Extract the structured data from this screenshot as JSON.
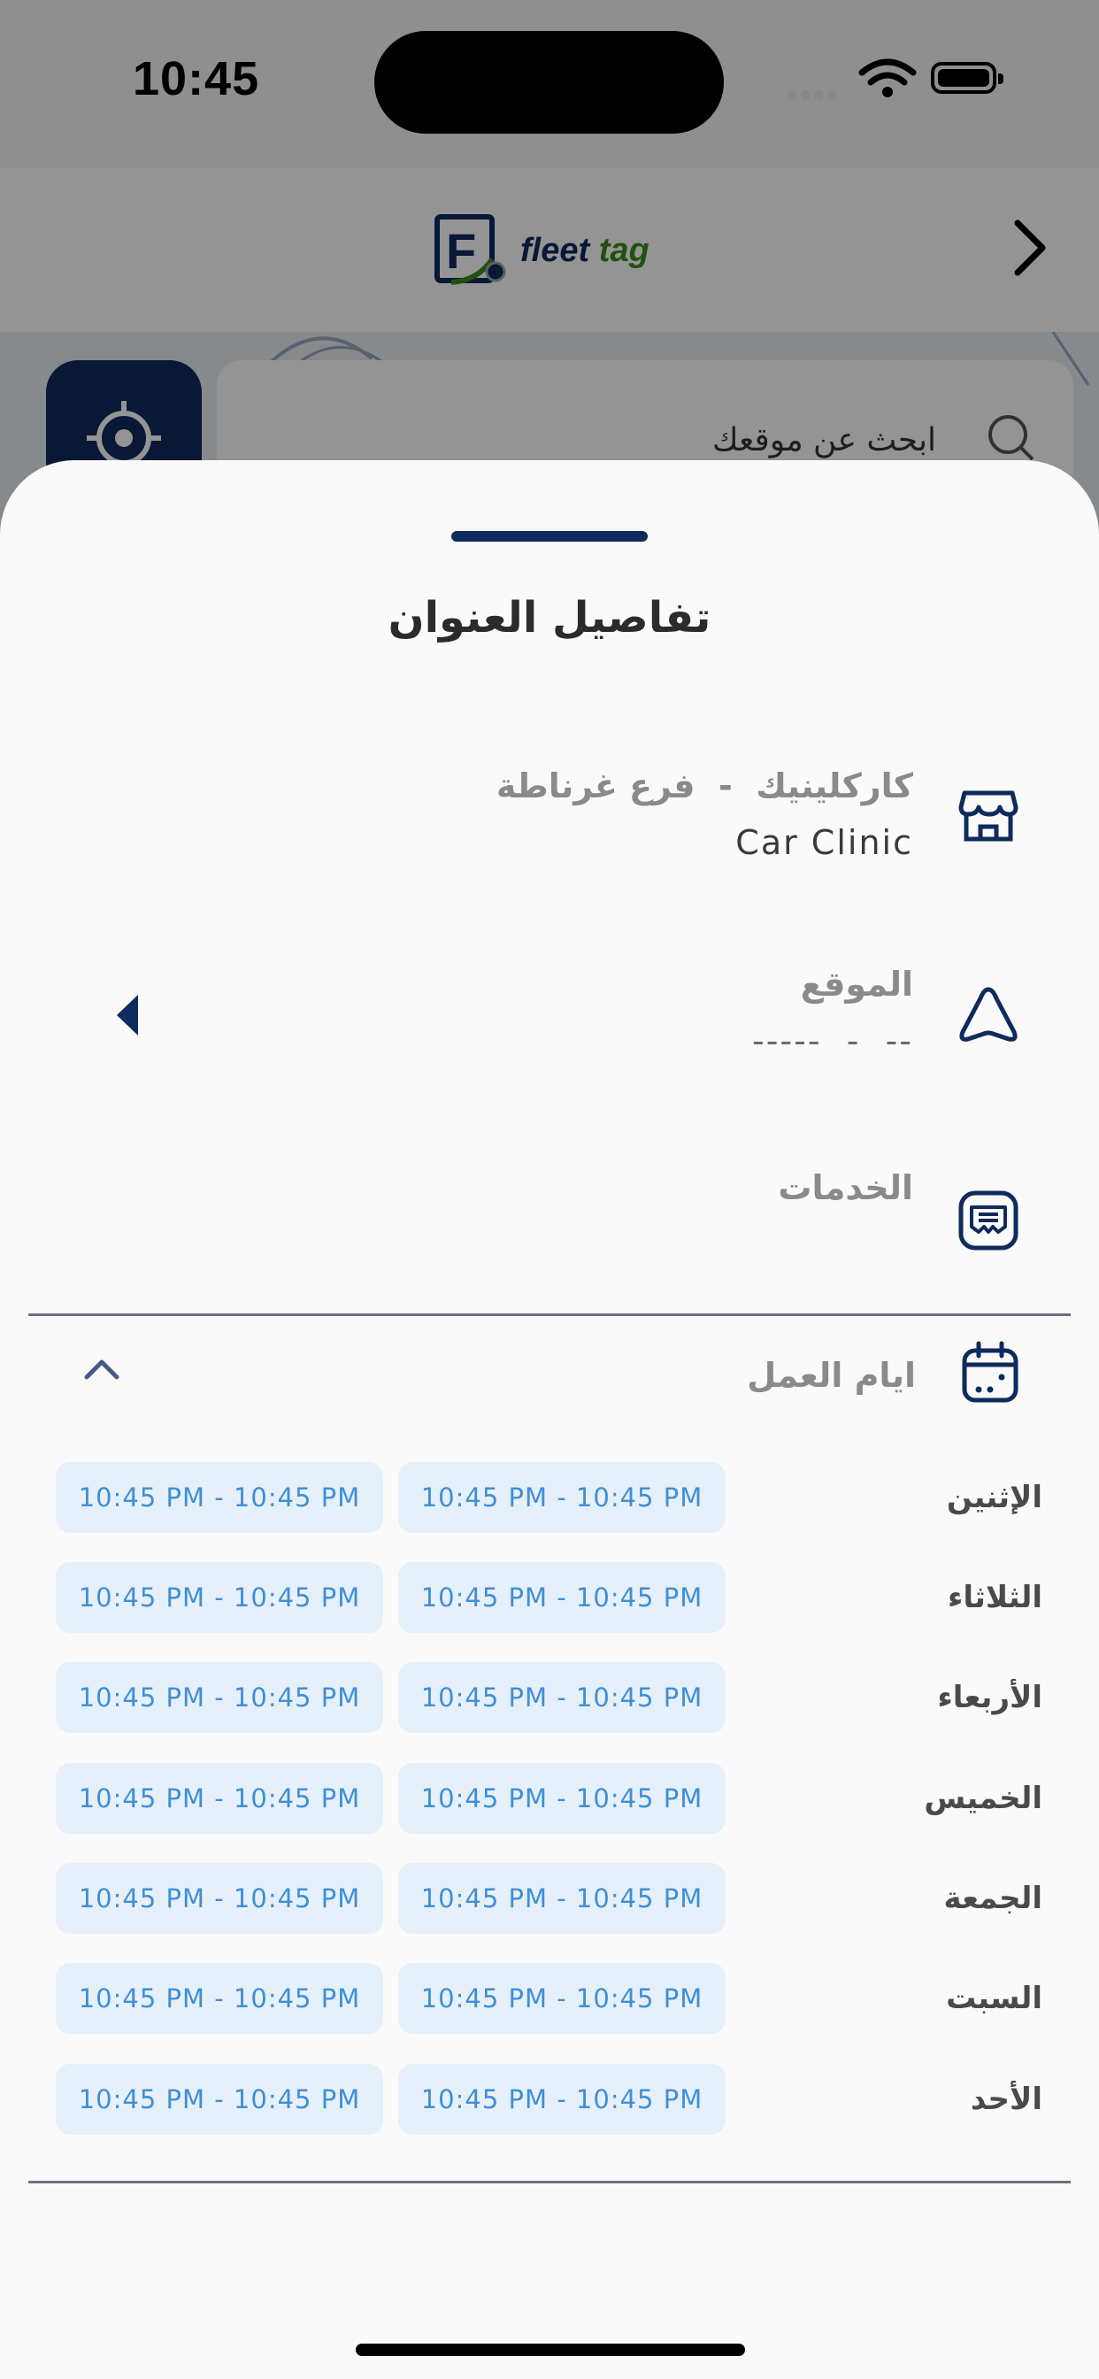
{
  "status_bar": {
    "time": "10:45"
  },
  "header": {
    "logo_letter": "F",
    "logo_word1": "fleet",
    "logo_word2": "tag"
  },
  "search": {
    "placeholder": "ابحث عن موقعك"
  },
  "sheet": {
    "title": "تفاصيل العنوان",
    "branch": {
      "name": "كاركلينيك  -  فرع غرناطة",
      "subtitle": "Car Clinic"
    },
    "location": {
      "label": "الموقع",
      "value": "-----  -  --"
    },
    "services": {
      "label": "الخدمات"
    },
    "working_days": {
      "label": "ايام العمل",
      "days": [
        {
          "day": "الإثنين",
          "slots": [
            "10:45 PM - 10:45 PM",
            "10:45 PM - 10:45 PM"
          ]
        },
        {
          "day": "الثلاثاء",
          "slots": [
            "10:45 PM - 10:45 PM",
            "10:45 PM - 10:45 PM"
          ]
        },
        {
          "day": "الأربعاء",
          "slots": [
            "10:45 PM - 10:45 PM",
            "10:45 PM - 10:45 PM"
          ]
        },
        {
          "day": "الخميس",
          "slots": [
            "10:45 PM - 10:45 PM",
            "10:45 PM - 10:45 PM"
          ]
        },
        {
          "day": "الجمعة",
          "slots": [
            "10:45 PM - 10:45 PM",
            "10:45 PM - 10:45 PM"
          ]
        },
        {
          "day": "السبت",
          "slots": [
            "10:45 PM - 10:45 PM",
            "10:45 PM - 10:45 PM"
          ]
        },
        {
          "day": "الأحد",
          "slots": [
            "10:45 PM - 10:45 PM",
            "10:45 PM - 10:45 PM"
          ]
        }
      ]
    }
  },
  "colors": {
    "brand_navy": "#0f2a5c",
    "brand_green": "#3c8a1e",
    "slot_bg": "#e6f0fb",
    "slot_text": "#3f8fd6"
  },
  "icons": {
    "branch": "store-icon",
    "location": "navigation-arrow-icon",
    "services": "receipt-icon",
    "working_days": "calendar-icon",
    "back": "chevron-right-icon",
    "collapse": "chevron-up-icon",
    "expand": "caret-left-icon",
    "locate": "crosshair-icon",
    "search": "search-icon"
  }
}
